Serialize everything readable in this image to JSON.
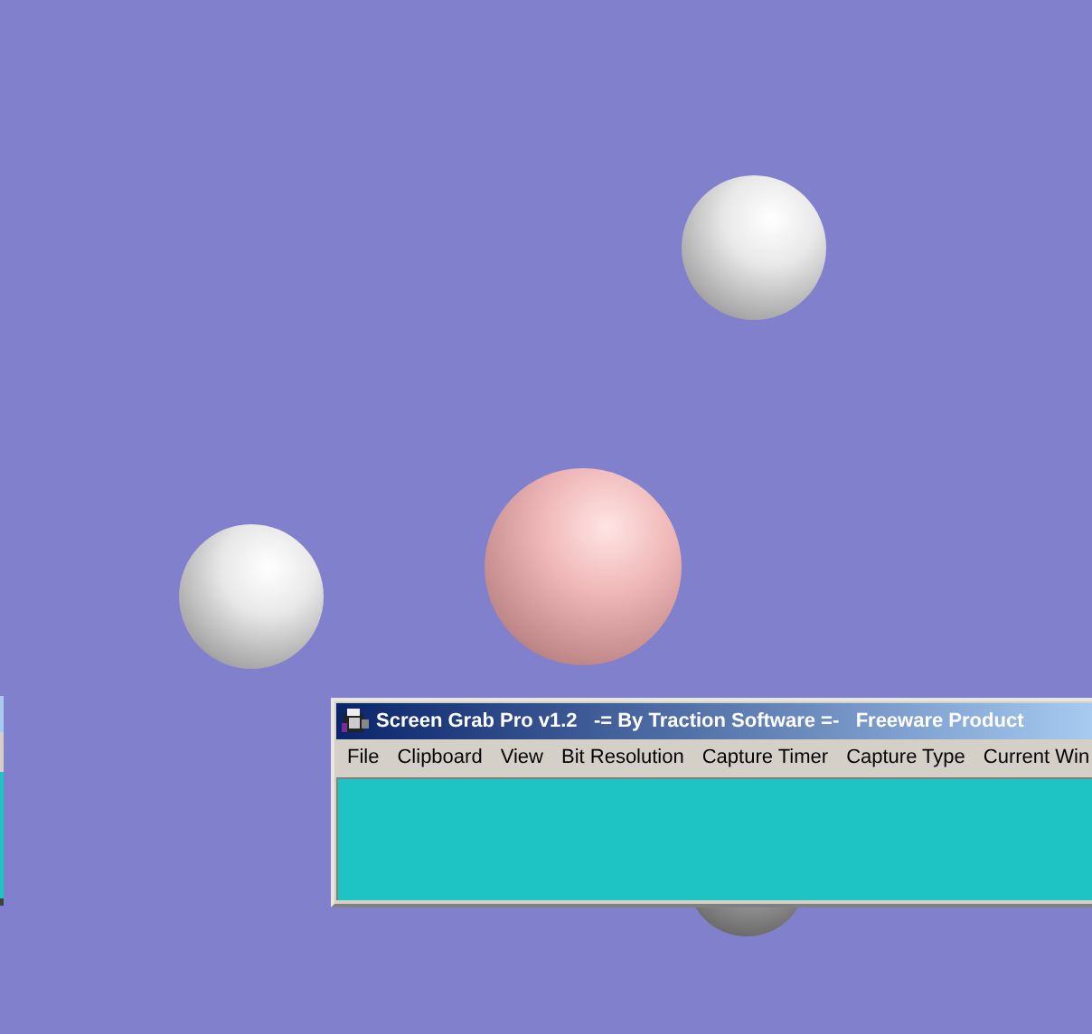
{
  "window": {
    "title": "Screen Grab Pro v1.2   -= By Traction Software =-   Freeware Product"
  },
  "menu": [
    "File",
    "Clipboard",
    "View",
    "Bit Resolution",
    "Capture Timer",
    "Capture Type",
    "Current Win"
  ]
}
